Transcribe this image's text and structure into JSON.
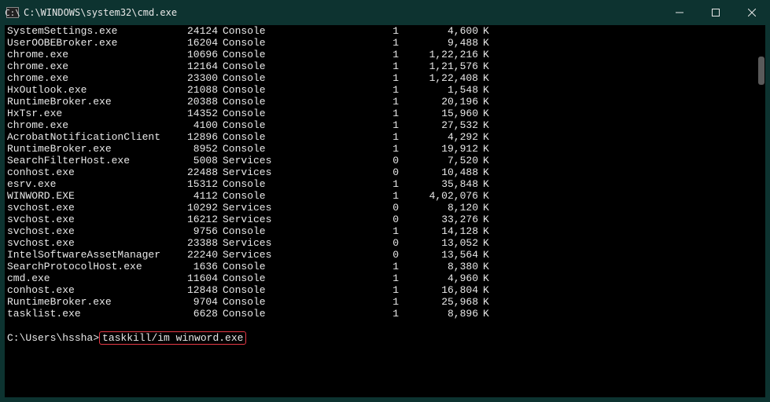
{
  "titlebar": {
    "icon_label": "C:\\",
    "title": "C:\\WINDOWS\\system32\\cmd.exe"
  },
  "processes": [
    {
      "name": "SystemSettings.exe",
      "pid": "24124",
      "session": "Console",
      "sessnum": "1",
      "mem": "4,600",
      "k": "K"
    },
    {
      "name": "UserOOBEBroker.exe",
      "pid": "16204",
      "session": "Console",
      "sessnum": "1",
      "mem": "9,488",
      "k": "K"
    },
    {
      "name": "chrome.exe",
      "pid": "10696",
      "session": "Console",
      "sessnum": "1",
      "mem": "1,22,216",
      "k": "K"
    },
    {
      "name": "chrome.exe",
      "pid": "12164",
      "session": "Console",
      "sessnum": "1",
      "mem": "1,21,576",
      "k": "K"
    },
    {
      "name": "chrome.exe",
      "pid": "23300",
      "session": "Console",
      "sessnum": "1",
      "mem": "1,22,408",
      "k": "K"
    },
    {
      "name": "HxOutlook.exe",
      "pid": "21088",
      "session": "Console",
      "sessnum": "1",
      "mem": "1,548",
      "k": "K"
    },
    {
      "name": "RuntimeBroker.exe",
      "pid": "20388",
      "session": "Console",
      "sessnum": "1",
      "mem": "20,196",
      "k": "K"
    },
    {
      "name": "HxTsr.exe",
      "pid": "14352",
      "session": "Console",
      "sessnum": "1",
      "mem": "15,960",
      "k": "K"
    },
    {
      "name": "chrome.exe",
      "pid": "4100",
      "session": "Console",
      "sessnum": "1",
      "mem": "27,532",
      "k": "K"
    },
    {
      "name": "AcrobatNotificationClient",
      "pid": "12896",
      "session": "Console",
      "sessnum": "1",
      "mem": "4,292",
      "k": "K"
    },
    {
      "name": "RuntimeBroker.exe",
      "pid": "8952",
      "session": "Console",
      "sessnum": "1",
      "mem": "19,912",
      "k": "K"
    },
    {
      "name": "SearchFilterHost.exe",
      "pid": "5008",
      "session": "Services",
      "sessnum": "0",
      "mem": "7,520",
      "k": "K"
    },
    {
      "name": "conhost.exe",
      "pid": "22488",
      "session": "Services",
      "sessnum": "0",
      "mem": "10,488",
      "k": "K"
    },
    {
      "name": "esrv.exe",
      "pid": "15312",
      "session": "Console",
      "sessnum": "1",
      "mem": "35,848",
      "k": "K"
    },
    {
      "name": "WINWORD.EXE",
      "pid": "4112",
      "session": "Console",
      "sessnum": "1",
      "mem": "4,02,076",
      "k": "K"
    },
    {
      "name": "svchost.exe",
      "pid": "10292",
      "session": "Services",
      "sessnum": "0",
      "mem": "8,120",
      "k": "K"
    },
    {
      "name": "svchost.exe",
      "pid": "16212",
      "session": "Services",
      "sessnum": "0",
      "mem": "33,276",
      "k": "K"
    },
    {
      "name": "svchost.exe",
      "pid": "9756",
      "session": "Console",
      "sessnum": "1",
      "mem": "14,128",
      "k": "K"
    },
    {
      "name": "svchost.exe",
      "pid": "23388",
      "session": "Services",
      "sessnum": "0",
      "mem": "13,052",
      "k": "K"
    },
    {
      "name": "IntelSoftwareAssetManager",
      "pid": "22240",
      "session": "Services",
      "sessnum": "0",
      "mem": "13,564",
      "k": "K"
    },
    {
      "name": "SearchProtocolHost.exe",
      "pid": "1636",
      "session": "Console",
      "sessnum": "1",
      "mem": "8,380",
      "k": "K"
    },
    {
      "name": "cmd.exe",
      "pid": "11604",
      "session": "Console",
      "sessnum": "1",
      "mem": "4,960",
      "k": "K"
    },
    {
      "name": "conhost.exe",
      "pid": "12848",
      "session": "Console",
      "sessnum": "1",
      "mem": "16,804",
      "k": "K"
    },
    {
      "name": "RuntimeBroker.exe",
      "pid": "9704",
      "session": "Console",
      "sessnum": "1",
      "mem": "25,968",
      "k": "K"
    },
    {
      "name": "tasklist.exe",
      "pid": "6628",
      "session": "Console",
      "sessnum": "1",
      "mem": "8,896",
      "k": "K"
    }
  ],
  "prompt": {
    "path": "C:\\Users\\hssha>",
    "command": "taskkill/im winword.exe"
  }
}
